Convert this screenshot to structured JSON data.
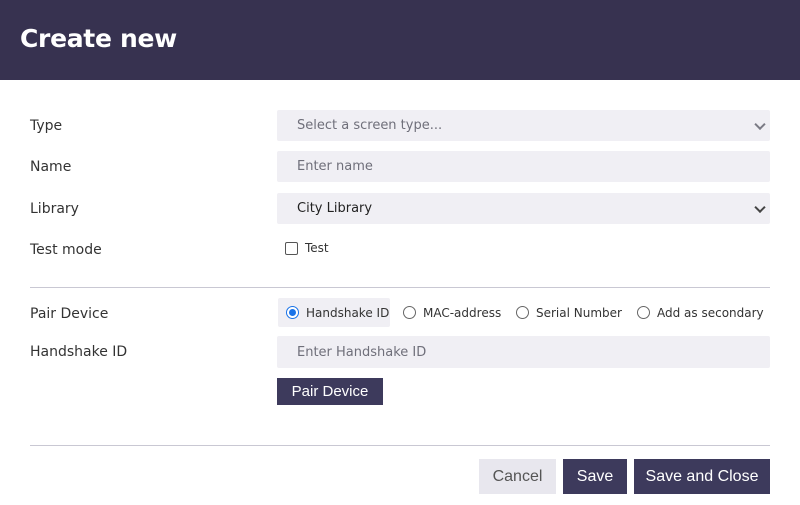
{
  "dialog": {
    "title": "Create new"
  },
  "form": {
    "type": {
      "label": "Type",
      "placeholder": "Select a screen type..."
    },
    "name": {
      "label": "Name",
      "placeholder": "Enter name"
    },
    "library": {
      "label": "Library",
      "value": "City Library"
    },
    "test_mode": {
      "label": "Test mode",
      "checkbox_label": "Test",
      "checked": false
    }
  },
  "pair": {
    "label": "Pair Device",
    "options": [
      {
        "label": "Handshake ID",
        "selected": true
      },
      {
        "label": "MAC-address",
        "selected": false
      },
      {
        "label": "Serial Number",
        "selected": false
      },
      {
        "label": "Add as secondary",
        "selected": false
      }
    ],
    "handshake": {
      "label": "Handshake ID",
      "placeholder": "Enter Handshake ID"
    },
    "button_label": "Pair Device"
  },
  "footer": {
    "cancel_label": "Cancel",
    "save_label": "Save",
    "save_close_label": "Save and Close"
  },
  "colors": {
    "header_bg": "#373250",
    "primary_button": "#3d3a5c",
    "field_bg": "#f0eff4",
    "radio_accent": "#1a73e8"
  }
}
